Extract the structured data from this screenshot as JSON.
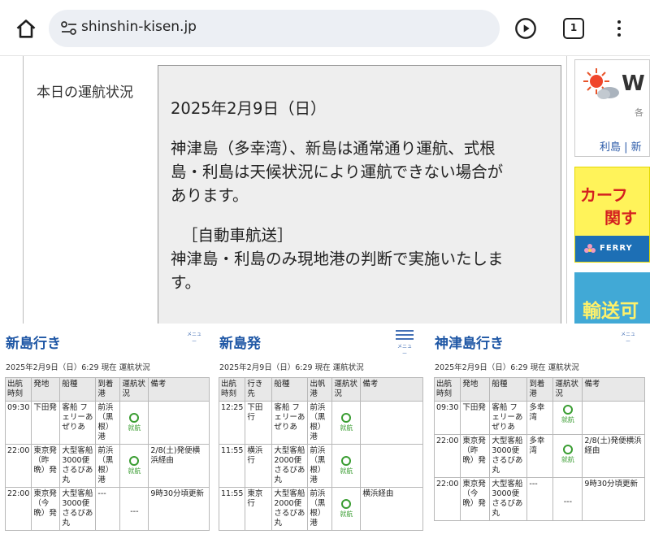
{
  "browser": {
    "url": "shinshin-kisen.jp",
    "tab_count": "1",
    "icons": [
      "home-icon",
      "site-settings-icon",
      "play-icon",
      "tabs-icon",
      "more-vert-icon"
    ]
  },
  "status": {
    "label": "本日の運航状況",
    "date": "2025年2月9日（日）",
    "line1a": "神津島（多幸湾）、新島は通常通り運航、式根",
    "line1b": "島・利島は天候状況により運航できない場合が",
    "line1c": "あります。",
    "line2": "［自動車航送］",
    "line3a": "神津島・利島のみ現地港の判断で実施いたしま",
    "line3b": "す。"
  },
  "rail": {
    "weather_title": "W",
    "weather_sub": "各",
    "weather_links": "利島 | 新",
    "car_line1": "カーフ",
    "car_line2": "関す",
    "ferry_text": "FERRY",
    "transport_text": "輸送可"
  },
  "panels": [
    {
      "title": "新島行き",
      "menu_label": "メニュー",
      "date": "2025年2月9日（日）6:29 現在 運航状況",
      "headers": [
        "出航時刻",
        "発地",
        "船種",
        "到着港",
        "運航状況",
        "備考"
      ],
      "rows": [
        [
          "09:30",
          "下田発",
          "客船 フェリーあぜりあ",
          "前浜（黒根）港",
          "就航",
          ""
        ],
        [
          "22:00",
          "東京発（昨晩）発",
          "大型客船3000便さるびあ丸",
          "前浜（黒根）港",
          "就航",
          "2/8(土)発便横浜経由"
        ],
        [
          "22:00",
          "東京発（今晩）発",
          "大型客船3000便さるびあ丸",
          "---",
          "---",
          "9時30分頃更新"
        ]
      ]
    },
    {
      "title": "新島発",
      "menu_label": "メニュー",
      "date": "2025年2月9日（日）6:29 現在 運航状況",
      "headers": [
        "出航時刻",
        "行き先",
        "船種",
        "出帆港",
        "運航状況",
        "備考"
      ],
      "rows": [
        [
          "12:25",
          "下田行",
          "客船 フェリーあぜりあ",
          "前浜（黒根）港",
          "就航",
          ""
        ],
        [
          "11:55",
          "横浜行",
          "大型客船2000便さるびあ丸",
          "前浜（黒根）港",
          "就航",
          ""
        ],
        [
          "11:55",
          "東京行",
          "大型客船2000便さるびあ丸",
          "前浜（黒根）港",
          "就航",
          "横浜経由"
        ]
      ]
    },
    {
      "title": "神津島行き",
      "menu_label": "メニュー",
      "date": "2025年2月9日（日）6:29 現在 運航状況",
      "headers": [
        "出航時刻",
        "発地",
        "船種",
        "到着港",
        "運航状況",
        "備考"
      ],
      "rows": [
        [
          "09:30",
          "下田発",
          "客船 フェリーあぜりあ",
          "多幸湾",
          "就航",
          ""
        ],
        [
          "22:00",
          "東京発（昨晩）発",
          "大型客船3000便さるびあ丸",
          "多幸湾",
          "就航",
          "2/8(土)発便横浜経由"
        ],
        [
          "22:00",
          "東京発（今晩）発",
          "大型客船3000便さるびあ丸",
          "---",
          "---",
          "9時30分頃更新"
        ]
      ]
    }
  ],
  "colors": {
    "link_blue": "#1f57a5",
    "status_green": "#3a9d32",
    "banner_yellow": "#fff35a",
    "banner_red": "#d41f1f"
  }
}
